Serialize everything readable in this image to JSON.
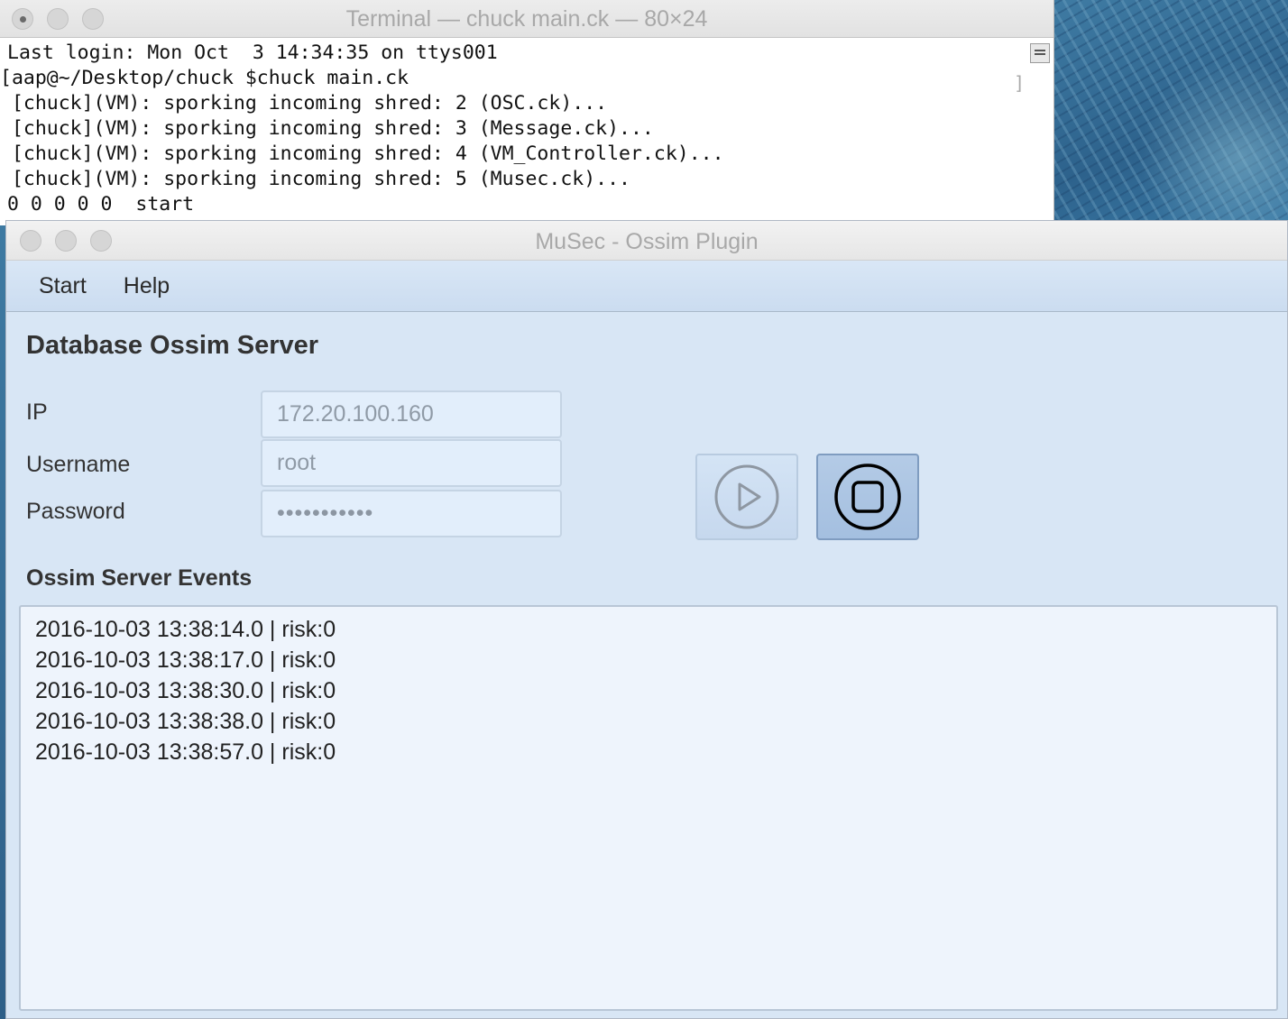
{
  "terminal": {
    "title": "Terminal — chuck main.ck — 80×24",
    "lines": [
      "Last login: Mon Oct  3 14:34:35 on ttys001",
      "[aap@~/Desktop/chuck $chuck main.ck",
      " [chuck](VM): sporking incoming shred: 2 (OSC.ck)...",
      " [chuck](VM): sporking incoming shred: 3 (Message.ck)...",
      " [chuck](VM): sporking incoming shred: 4 (VM_Controller.ck)...",
      " [chuck](VM): sporking incoming shred: 5 (Musec.ck)...",
      "0 0 0 0 0  start"
    ],
    "right_bracket": "]"
  },
  "app": {
    "title": "MuSec - Ossim Plugin",
    "menu": {
      "start": "Start",
      "help": "Help"
    },
    "database_section_title": "Database Ossim Server",
    "fields": {
      "ip_label": "IP",
      "ip_value": "172.20.100.160",
      "username_label": "Username",
      "username_value": "root",
      "password_label": "Password",
      "password_value": "•••••••••••"
    },
    "buttons": {
      "play_icon": "play-circle-icon",
      "stop_icon": "stop-circle-icon"
    },
    "events_section_title": "Ossim Server Events",
    "events": [
      "2016-10-03 13:38:14.0 | risk:0",
      "2016-10-03 13:38:17.0 | risk:0",
      "2016-10-03 13:38:30.0 | risk:0",
      "2016-10-03 13:38:38.0 | risk:0",
      "2016-10-03 13:38:57.0 | risk:0"
    ]
  },
  "colors": {
    "app_background": "#d8e6f5",
    "menubar": "#cbdcf0",
    "stop_button": "#a4bfe0",
    "play_button": "#c6d8ee"
  }
}
